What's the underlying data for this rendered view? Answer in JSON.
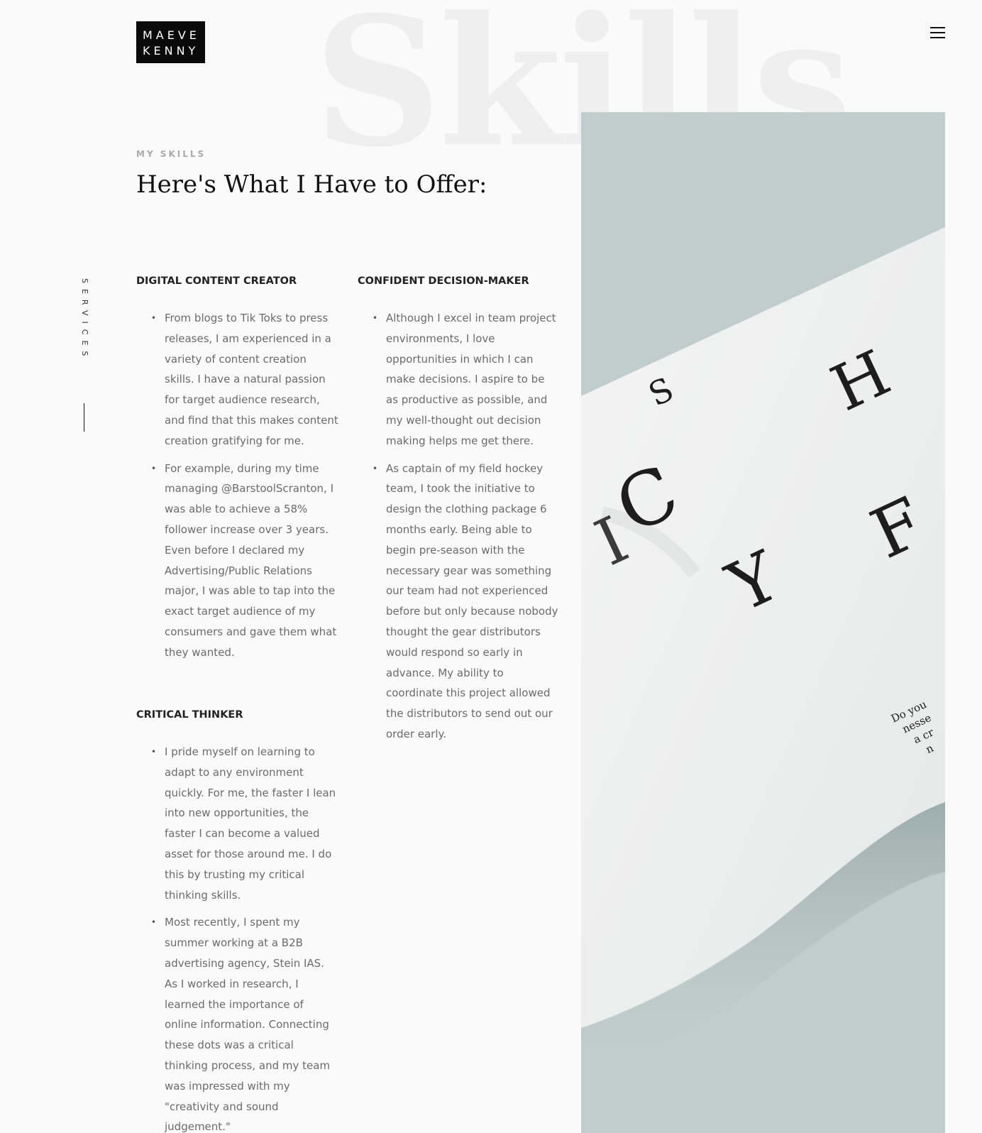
{
  "logo": {
    "line1": "MAEVE",
    "line2": "KENNY"
  },
  "menu_icon": "hamburger-menu-icon",
  "background_word": "Skills",
  "side_nav": {
    "label": "SERVICES"
  },
  "header": {
    "eyebrow": "MY SKILLS",
    "title": "Here's What I Have to Offer:"
  },
  "skills": [
    {
      "heading": "DIGITAL CONTENT CREATOR",
      "points": [
        "From blogs to Tik Toks to press releases, I am experienced in a variety of content creation skills. I have a natural passion for target audience research, and find that this makes content creation gratifying for me.",
        "For example, during my time managing @BarstoolScranton, I was able to achieve a 58% follower increase over 3 years. Even before I declared my Advertising/Public Relations major, I was able to tap into the exact target audience of my consumers and gave them what they wanted."
      ]
    },
    {
      "heading": "CONFIDENT DECISION-MAKER",
      "points": [
        "Although I excel in team project environments, I love opportunities in which I can make decisions. I aspire to be as productive as possible, and my well-thought out decision making helps me get there.",
        "As captain of my field hockey team, I took the initiative to design the clothing package 6 months early. Being able to begin pre-season with the necessary gear was something our team had not experienced before but only because nobody thought the gear distributors would respond so early in advance. My ability to coordinate this project allowed the distributors to send out our order early."
      ]
    },
    {
      "heading": "CRITICAL THINKER",
      "points": [
        "I pride myself on learning to adapt to any environment quickly. For me, the faster I lean into new opportunities, the faster I can become a valued asset for those around me. I do this by trusting my critical thinking skills.",
        "Most recently, I spent my summer working at a B2B advertising agency, Stein IAS. As I worked in research, I learned the importance of online information. Connecting these dots was a critical thinking process, and my team was impressed with my \"creativity and sound judgement.\""
      ]
    }
  ],
  "photo": {
    "letters": [
      "S",
      "H",
      "C",
      "I",
      "Y",
      "F"
    ],
    "snippet": [
      "Do you",
      "nesse",
      "a cr",
      "n"
    ]
  }
}
